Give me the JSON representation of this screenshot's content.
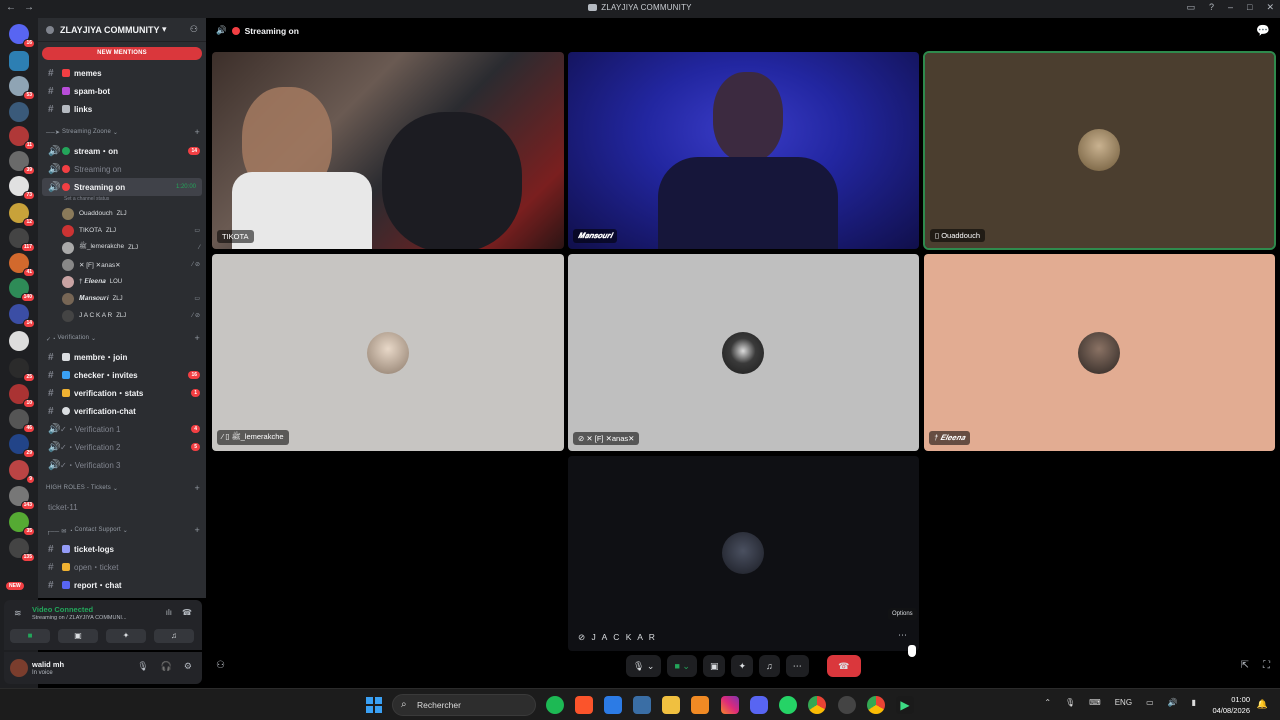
{
  "window": {
    "title": "ZLAYJIYA COMMUNITY"
  },
  "server": {
    "name": "ZLAYJIYA COMMUNITY",
    "new_mentions": "NEW MENTIONS"
  },
  "channels_top": [
    {
      "name": "memes",
      "color": "#f23f43"
    },
    {
      "name": "spam-bot",
      "color": "#b84dd9"
    },
    {
      "name": "links",
      "color": "#b5bac1"
    }
  ],
  "cat_streaming": "Streaming Zoone",
  "stream_channels": [
    {
      "name": "stream・on",
      "count": "14",
      "color": "#23a55a"
    },
    {
      "name": "Streaming on",
      "color": "#f23f43"
    }
  ],
  "active_channel": {
    "name": "Streaming on",
    "time": "1:20:00",
    "status_hint": "Set a channel status"
  },
  "voice_users": [
    {
      "name": "Ouaddouch",
      "tag": "ZLJ",
      "color": "#8a7a5a",
      "icons": ""
    },
    {
      "name": "TIKOTA",
      "tag": "ZLJ",
      "color": "#c33",
      "icons": "▭"
    },
    {
      "name": "ﷺ_lemerakche",
      "tag": "ZLJ",
      "color": "#aaa",
      "icons": "⁄"
    },
    {
      "name": "✕ [F] ✕anas✕",
      "tag": "",
      "color": "#888",
      "icons": "⁄ ⊘"
    },
    {
      "name": "† 𝑬𝒍𝒆𝒆𝒏𝒂",
      "tag": "LOU",
      "color": "#c9a3a3",
      "icons": ""
    },
    {
      "name": "𝑴𝒂𝒏𝒔𝒐𝒖𝒓𝒊",
      "tag": "ZLJ",
      "color": "#776655",
      "icons": "▭"
    },
    {
      "name": "J A C K A R",
      "tag": "ZLJ",
      "color": "#444",
      "icons": "⁄ ⊘"
    }
  ],
  "cat_verification": "Verification",
  "verif_channels": [
    {
      "name": "membre・join",
      "count": "",
      "bold": true
    },
    {
      "name": "checker・invites",
      "count": "16",
      "bold": true
    },
    {
      "name": "verification・stats",
      "count": "1",
      "bold": true
    },
    {
      "name": "verification-chat",
      "count": "",
      "bold": true
    },
    {
      "name": "✓・Verification 1",
      "count": "4",
      "bold": false
    },
    {
      "name": "✓・Verification 2",
      "count": "5",
      "bold": false
    },
    {
      "name": "✓・Verification 3",
      "count": "",
      "bold": false
    }
  ],
  "cat_high_roles": "HIGH ROLES - Tickets",
  "ticket_channel": "ticket-11",
  "cat_support": "Contact Support",
  "support_channels": [
    {
      "name": "ticket-logs",
      "bold": true
    },
    {
      "name": "open・ticket",
      "bold": false
    },
    {
      "name": "report・chat",
      "bold": true
    }
  ],
  "voice_panel": {
    "status": "Video Connected",
    "sub": "Streaming on / ZLAYJIYA COMMUNI..."
  },
  "user": {
    "name": "walid mh",
    "status": "In voice"
  },
  "topbar": {
    "channel": "Streaming on"
  },
  "tiles": [
    {
      "label": "TIKOTA",
      "kind": "video"
    },
    {
      "label": "𝑴𝒂𝒏𝒔𝒐𝒖𝒓𝒊",
      "kind": "video"
    },
    {
      "label": "▯ Ouaddouch",
      "kind": "avatar"
    },
    {
      "label": "⁄ ▯ ﷺ_lemerakche",
      "kind": "avatar"
    },
    {
      "label": "⊘ ✕ [F] ✕anas✕",
      "kind": "avatar"
    },
    {
      "label": "† 𝑬𝒍𝒆𝒆𝒏𝒂",
      "kind": "avatar"
    },
    {
      "label": "⊘ J A C K A R",
      "kind": "avatar"
    }
  ],
  "tooltip": "Options",
  "taskbar": {
    "search_placeholder": "Rechercher",
    "lang": "ENG",
    "time": "01:00",
    "date": "04/08/2026"
  },
  "guild_badges": [
    "16",
    "53",
    "11",
    "39",
    "73",
    "12",
    "117",
    "41",
    "140",
    "14",
    "25",
    "10",
    "46",
    "29",
    "9",
    "143",
    "35",
    "135"
  ],
  "colors": {
    "accent_green": "#23a55a",
    "danger": "#da373c",
    "speaking_border": "#2f8a4d"
  }
}
